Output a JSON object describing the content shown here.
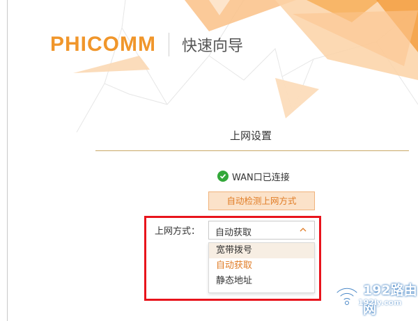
{
  "header": {
    "logo_text": "PHICOMM",
    "subtitle": "快速向导"
  },
  "section": {
    "title": "上网设置"
  },
  "status": {
    "text": "WAN口已连接",
    "icon": "check-circle-icon",
    "color": "#33a83a"
  },
  "detect_button": {
    "label": "自动检测上网方式"
  },
  "connection_type": {
    "label": "上网方式：",
    "selected": "自动获取",
    "options": [
      "宽带拨号",
      "自动获取",
      "静态地址"
    ]
  },
  "watermark": {
    "brand": "192路由网",
    "url": "192ly.com"
  },
  "colors": {
    "brand_orange": "#f0962b",
    "accent_orange": "#e07b24",
    "highlight_red": "#e8141c"
  }
}
